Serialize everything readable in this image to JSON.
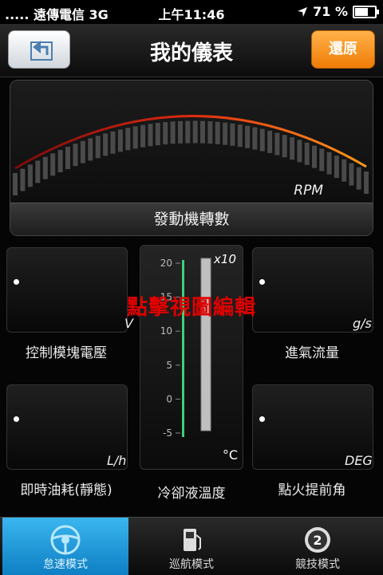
{
  "status_bar": {
    "carrier": ".....  遠傳電信  3G",
    "time": "上午11:46",
    "battery_text": "71 %",
    "battery_level": 0.71
  },
  "header": {
    "title": "我的儀表",
    "reset_label": "還原",
    "back_icon": "back-arrow-icon"
  },
  "rpm_gauge": {
    "unit": "RPM",
    "label": "發動機轉數"
  },
  "gauges": {
    "throttle_voltage": {
      "unit": "V",
      "label": "控制模塊電壓"
    },
    "air_flow": {
      "unit": "g/s",
      "label": "進氣流量"
    },
    "fuel_consumption": {
      "unit": "L/h",
      "label": "即時油耗(靜態)"
    },
    "ignition_advance": {
      "unit": "DEG",
      "label": "點火提前角"
    },
    "coolant_temp": {
      "multiplier": "x10",
      "unit": "°C",
      "label": "冷卻液溫度",
      "ticks": [
        "20",
        "15",
        "10",
        "5",
        "0",
        "-5"
      ]
    }
  },
  "overlay_text": "點擊視圖編輯",
  "tabs": [
    {
      "label": "怠速模式",
      "icon": "steering-wheel-icon",
      "active": true
    },
    {
      "label": "巡航模式",
      "icon": "fuel-pump-icon",
      "active": false
    },
    {
      "label": "競技模式",
      "icon": "speed-dial-icon",
      "active": false
    }
  ],
  "colors": {
    "accent_orange": "#f07c06",
    "active_tab": "#1a96d8",
    "overlay_red": "#e00000",
    "gauge_green": "#3fd07a"
  }
}
